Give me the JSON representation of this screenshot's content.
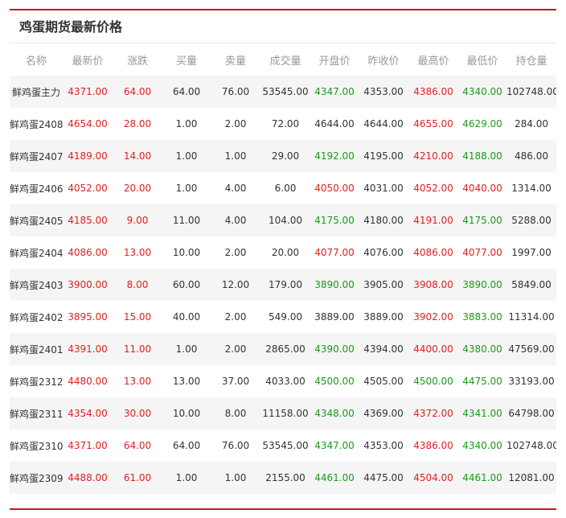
{
  "title": "鸡蛋期货最新价格",
  "colors": {
    "up": "#e02020",
    "down": "#1a9a1a",
    "accent": "#c8161d"
  },
  "columns": [
    "名称",
    "最新价",
    "涨跌",
    "买量",
    "卖量",
    "成交量",
    "开盘价",
    "昨收价",
    "最高价",
    "最低价",
    "持仓量"
  ],
  "rows": [
    {
      "name": "鲜鸡蛋主力",
      "last": "4371.00",
      "change": "64.00",
      "bid": "64.00",
      "ask": "76.00",
      "volume": "53545.00",
      "open": "4347.00",
      "prev": "4353.00",
      "high": "4386.00",
      "low": "4340.00",
      "oi": "102748.00",
      "open_dir": "down",
      "high_dir": "up",
      "low_dir": "down"
    },
    {
      "name": "鲜鸡蛋2408",
      "last": "4654.00",
      "change": "28.00",
      "bid": "1.00",
      "ask": "2.00",
      "volume": "72.00",
      "open": "4644.00",
      "prev": "4644.00",
      "high": "4655.00",
      "low": "4629.00",
      "oi": "284.00",
      "open_dir": "flat",
      "high_dir": "up",
      "low_dir": "down"
    },
    {
      "name": "鲜鸡蛋2407",
      "last": "4189.00",
      "change": "14.00",
      "bid": "1.00",
      "ask": "1.00",
      "volume": "29.00",
      "open": "4192.00",
      "prev": "4195.00",
      "high": "4210.00",
      "low": "4188.00",
      "oi": "486.00",
      "open_dir": "down",
      "high_dir": "up",
      "low_dir": "down"
    },
    {
      "name": "鲜鸡蛋2406",
      "last": "4052.00",
      "change": "20.00",
      "bid": "1.00",
      "ask": "4.00",
      "volume": "6.00",
      "open": "4050.00",
      "prev": "4031.00",
      "high": "4052.00",
      "low": "4040.00",
      "oi": "1314.00",
      "open_dir": "up",
      "high_dir": "up",
      "low_dir": "up"
    },
    {
      "name": "鲜鸡蛋2405",
      "last": "4185.00",
      "change": "9.00",
      "bid": "11.00",
      "ask": "4.00",
      "volume": "104.00",
      "open": "4175.00",
      "prev": "4180.00",
      "high": "4191.00",
      "low": "4175.00",
      "oi": "5288.00",
      "open_dir": "down",
      "high_dir": "up",
      "low_dir": "down"
    },
    {
      "name": "鲜鸡蛋2404",
      "last": "4086.00",
      "change": "13.00",
      "bid": "10.00",
      "ask": "2.00",
      "volume": "20.00",
      "open": "4077.00",
      "prev": "4076.00",
      "high": "4086.00",
      "low": "4077.00",
      "oi": "1997.00",
      "open_dir": "up",
      "high_dir": "up",
      "low_dir": "up"
    },
    {
      "name": "鲜鸡蛋2403",
      "last": "3900.00",
      "change": "8.00",
      "bid": "60.00",
      "ask": "12.00",
      "volume": "179.00",
      "open": "3890.00",
      "prev": "3905.00",
      "high": "3908.00",
      "low": "3890.00",
      "oi": "5849.00",
      "open_dir": "down",
      "high_dir": "up",
      "low_dir": "down"
    },
    {
      "name": "鲜鸡蛋2402",
      "last": "3895.00",
      "change": "15.00",
      "bid": "40.00",
      "ask": "2.00",
      "volume": "549.00",
      "open": "3889.00",
      "prev": "3889.00",
      "high": "3902.00",
      "low": "3883.00",
      "oi": "11314.00",
      "open_dir": "flat",
      "high_dir": "up",
      "low_dir": "down"
    },
    {
      "name": "鲜鸡蛋2401",
      "last": "4391.00",
      "change": "11.00",
      "bid": "1.00",
      "ask": "2.00",
      "volume": "2865.00",
      "open": "4390.00",
      "prev": "4394.00",
      "high": "4400.00",
      "low": "4380.00",
      "oi": "47569.00",
      "open_dir": "down",
      "high_dir": "up",
      "low_dir": "down"
    },
    {
      "name": "鲜鸡蛋2312",
      "last": "4480.00",
      "change": "13.00",
      "bid": "13.00",
      "ask": "37.00",
      "volume": "4033.00",
      "open": "4500.00",
      "prev": "4505.00",
      "high": "4500.00",
      "low": "4475.00",
      "oi": "33193.00",
      "open_dir": "down",
      "high_dir": "down",
      "low_dir": "down"
    },
    {
      "name": "鲜鸡蛋2311",
      "last": "4354.00",
      "change": "30.00",
      "bid": "10.00",
      "ask": "8.00",
      "volume": "11158.00",
      "open": "4348.00",
      "prev": "4369.00",
      "high": "4372.00",
      "low": "4341.00",
      "oi": "64798.00",
      "open_dir": "down",
      "high_dir": "up",
      "low_dir": "down"
    },
    {
      "name": "鲜鸡蛋2310",
      "last": "4371.00",
      "change": "64.00",
      "bid": "64.00",
      "ask": "76.00",
      "volume": "53545.00",
      "open": "4347.00",
      "prev": "4353.00",
      "high": "4386.00",
      "low": "4340.00",
      "oi": "102748.00",
      "open_dir": "down",
      "high_dir": "up",
      "low_dir": "down"
    },
    {
      "name": "鲜鸡蛋2309",
      "last": "4488.00",
      "change": "61.00",
      "bid": "1.00",
      "ask": "1.00",
      "volume": "2155.00",
      "open": "4461.00",
      "prev": "4475.00",
      "high": "4504.00",
      "low": "4461.00",
      "oi": "12081.00",
      "open_dir": "down",
      "high_dir": "up",
      "low_dir": "down"
    }
  ]
}
